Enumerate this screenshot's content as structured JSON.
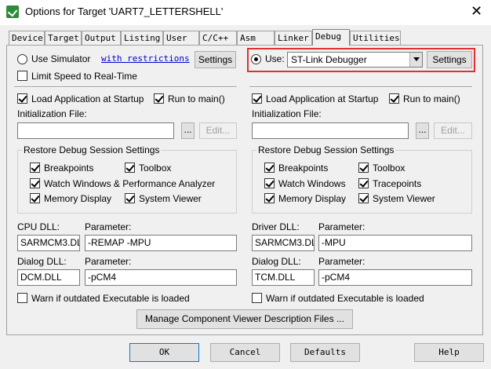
{
  "window": {
    "title": "Options for Target 'UART7_LETTERSHELL'"
  },
  "tabs": [
    {
      "label": "Device"
    },
    {
      "label": "Target"
    },
    {
      "label": "Output"
    },
    {
      "label": "Listing"
    },
    {
      "label": "User"
    },
    {
      "label": "C/C++"
    },
    {
      "label": "Asm"
    },
    {
      "label": "Linker"
    },
    {
      "label": "Debug"
    },
    {
      "label": "Utilities"
    }
  ],
  "active_tab": "Debug",
  "left": {
    "use_simulator_label": "Use Simulator",
    "restrictions_link": "with restrictions",
    "settings_label": "Settings",
    "limit_speed_label": "Limit Speed to Real-Time",
    "load_app_label": "Load Application at Startup",
    "run_to_main_label": "Run to main()",
    "init_file_label": "Initialization File:",
    "init_file_value": "",
    "browse_label": "...",
    "edit_label": "Edit...",
    "restore_title": "Restore Debug Session Settings",
    "restore_items": [
      "Breakpoints",
      "Toolbox",
      "Watch Windows & Performance Analyzer",
      "Memory Display",
      "System Viewer"
    ],
    "cpu_dll_label": "CPU DLL:",
    "cpu_param_label": "Parameter:",
    "cpu_dll_value": "SARMCM3.DLL",
    "cpu_param_value": "-REMAP -MPU",
    "dialog_dll_label": "Dialog DLL:",
    "dialog_param_label": "Parameter:",
    "dialog_dll_value": "DCM.DLL",
    "dialog_param_value": "-pCM4",
    "warn_label": "Warn if outdated Executable is loaded"
  },
  "right": {
    "use_label": "Use:",
    "debugger_value": "ST-Link Debugger",
    "settings_label": "Settings",
    "load_app_label": "Load Application at Startup",
    "run_to_main_label": "Run to main()",
    "init_file_label": "Initialization File:",
    "init_file_value": "",
    "browse_label": "...",
    "edit_label": "Edit...",
    "restore_title": "Restore Debug Session Settings",
    "restore_items": [
      "Breakpoints",
      "Toolbox",
      "Watch Windows",
      "Tracepoints",
      "Memory Display",
      "System Viewer"
    ],
    "driver_dll_label": "Driver DLL:",
    "driver_param_label": "Parameter:",
    "driver_dll_value": "SARMCM3.DLL",
    "driver_param_value": "-MPU",
    "dialog_dll_label": "Dialog DLL:",
    "dialog_param_label": "Parameter:",
    "dialog_dll_value": "TCM.DLL",
    "dialog_param_value": "-pCM4",
    "warn_label": "Warn if outdated Executable is loaded"
  },
  "manage_button_label": "Manage Component Viewer Description Files ...",
  "footer": {
    "ok_label": "OK",
    "cancel_label": "Cancel",
    "defaults_label": "Defaults",
    "help_label": "Help"
  },
  "colors": {
    "highlight": "#e03030",
    "dialog_bg": "#f0f0f0",
    "link": "#0000cc"
  }
}
